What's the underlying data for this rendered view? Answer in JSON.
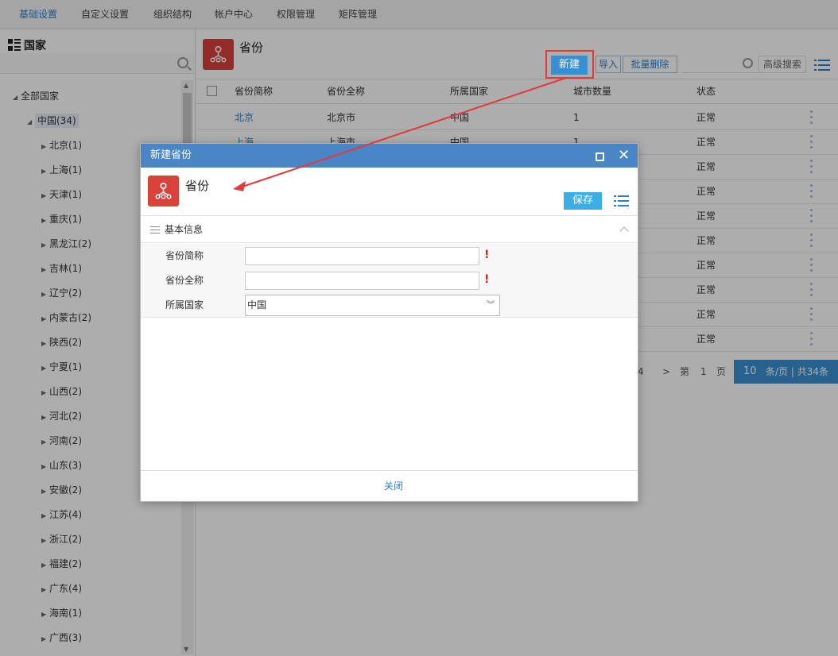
{
  "topnav": {
    "tabs": [
      {
        "label": "基础设置",
        "active": true
      },
      {
        "label": "自定义设置",
        "active": false
      },
      {
        "label": "组织结构",
        "active": false
      },
      {
        "label": "帐户中心",
        "active": false
      },
      {
        "label": "权限管理",
        "active": false
      },
      {
        "label": "矩阵管理",
        "active": false
      }
    ]
  },
  "sidebar": {
    "title": "国家",
    "tree": {
      "root": "全部国家",
      "country": "中国(34)",
      "provinces": [
        "北京(1)",
        "上海(1)",
        "天津(1)",
        "重庆(1)",
        "黑龙江(2)",
        "吉林(1)",
        "辽宁(2)",
        "内蒙古(2)",
        "陕西(2)",
        "宁夏(1)",
        "山西(2)",
        "河北(2)",
        "河南(2)",
        "山东(3)",
        "安徽(2)",
        "江苏(4)",
        "浙江(2)",
        "福建(2)",
        "广东(4)",
        "海南(1)",
        "广西(3)"
      ]
    }
  },
  "main": {
    "title": "省份",
    "toolbar": {
      "new_label": "新建",
      "import_label": "导入",
      "batch_delete_label": "批量删除",
      "advanced_search_label": "高级搜索"
    },
    "table": {
      "headers": [
        "省份简称",
        "省份全称",
        "所属国家",
        "城市数量",
        "状态"
      ],
      "rows": [
        {
          "short": "北京",
          "full": "北京市",
          "country": "中国",
          "cities": "1",
          "status": "正常"
        },
        {
          "short": "上海",
          "full": "上海市",
          "country": "中国",
          "cities": "1",
          "status": "正常"
        },
        {
          "short": "",
          "full": "",
          "country": "",
          "cities": "",
          "status": "正常"
        },
        {
          "short": "",
          "full": "",
          "country": "",
          "cities": "",
          "status": "正常"
        },
        {
          "short": "",
          "full": "",
          "country": "",
          "cities": "",
          "status": "正常"
        },
        {
          "short": "",
          "full": "",
          "country": "",
          "cities": "",
          "status": "正常"
        },
        {
          "short": "",
          "full": "",
          "country": "",
          "cities": "",
          "status": "正常"
        },
        {
          "short": "",
          "full": "",
          "country": "",
          "cities": "",
          "status": "正常"
        },
        {
          "short": "",
          "full": "",
          "country": "",
          "cities": "",
          "status": "正常"
        },
        {
          "short": "",
          "full": "",
          "country": "",
          "cities": "",
          "status": "正常"
        }
      ]
    },
    "pager": {
      "last_page_fragment": "4",
      "next": ">",
      "page_prefix": "第",
      "page": "1",
      "page_suffix": "页",
      "page_size": "10",
      "summary": "条/页 | 共34条"
    }
  },
  "dialog": {
    "title": "新建省份",
    "form_title": "省份",
    "save_label": "保存",
    "section_label": "基本信息",
    "fields": {
      "short_name_label": "省份简称",
      "short_name_value": "",
      "full_name_label": "省份全称",
      "full_name_value": "",
      "country_label": "所属国家",
      "country_value": "中国",
      "required_mark": "!"
    },
    "close_label": "关闭"
  },
  "colors": {
    "accent": "#3a8fd1",
    "dialog_header": "#4a86c5",
    "save_button": "#3aaee6",
    "module_icon": "#d9413b",
    "annotation": "#e03a3a"
  }
}
